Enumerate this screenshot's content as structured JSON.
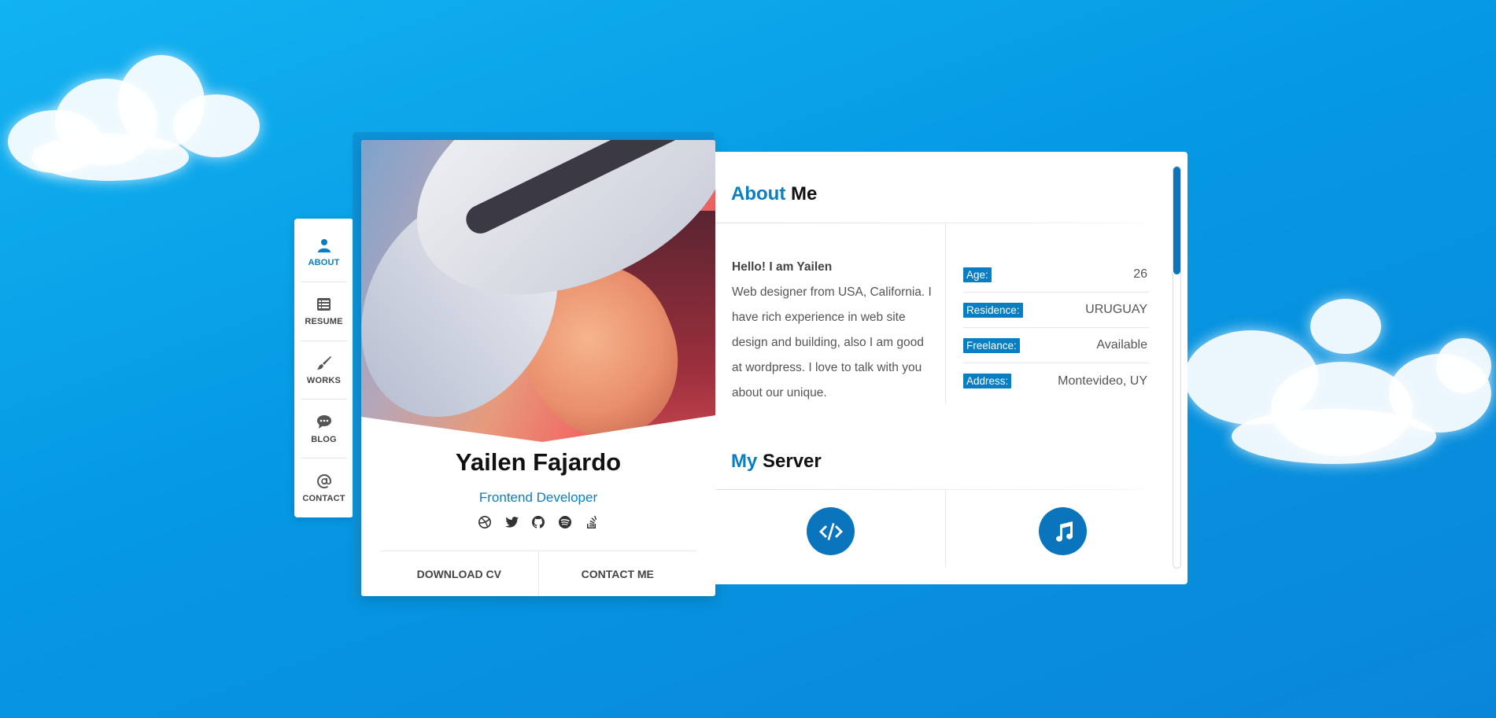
{
  "nav": {
    "items": [
      {
        "label": "ABOUT",
        "icon": "user-icon",
        "active": true
      },
      {
        "label": "RESUME",
        "icon": "list-icon",
        "active": false
      },
      {
        "label": "WORKS",
        "icon": "brush-icon",
        "active": false
      },
      {
        "label": "BLOG",
        "icon": "chat-icon",
        "active": false
      },
      {
        "label": "CONTACT",
        "icon": "at-icon",
        "active": false
      }
    ]
  },
  "profile": {
    "name": "Yailen Fajardo",
    "role": "Frontend Developer",
    "socials": [
      "dribbble-icon",
      "twitter-icon",
      "github-icon",
      "spotify-icon",
      "stackoverflow-icon"
    ],
    "download_label": "DOWNLOAD CV",
    "contact_label": "CONTACT ME"
  },
  "about": {
    "title_accent": "About",
    "title_rest": "Me",
    "greeting": "Hello! I am Yailen",
    "intro": "Web designer from USA, California. I have rich experience in web site design and building, also I am good at wordpress. I love to talk with you about our unique.",
    "info": [
      {
        "key": "Age:",
        "value": "26"
      },
      {
        "key": "Residence:",
        "value": "URUGUAY"
      },
      {
        "key": "Freelance:",
        "value": "Available"
      },
      {
        "key": "Address:",
        "value": "Montevideo, UY"
      }
    ]
  },
  "server": {
    "title_accent": "My",
    "title_rest": "Server",
    "services": [
      "code-icon",
      "music-icon"
    ]
  },
  "colors": {
    "accent": "#0a7ec2",
    "background": "#0598e3"
  }
}
